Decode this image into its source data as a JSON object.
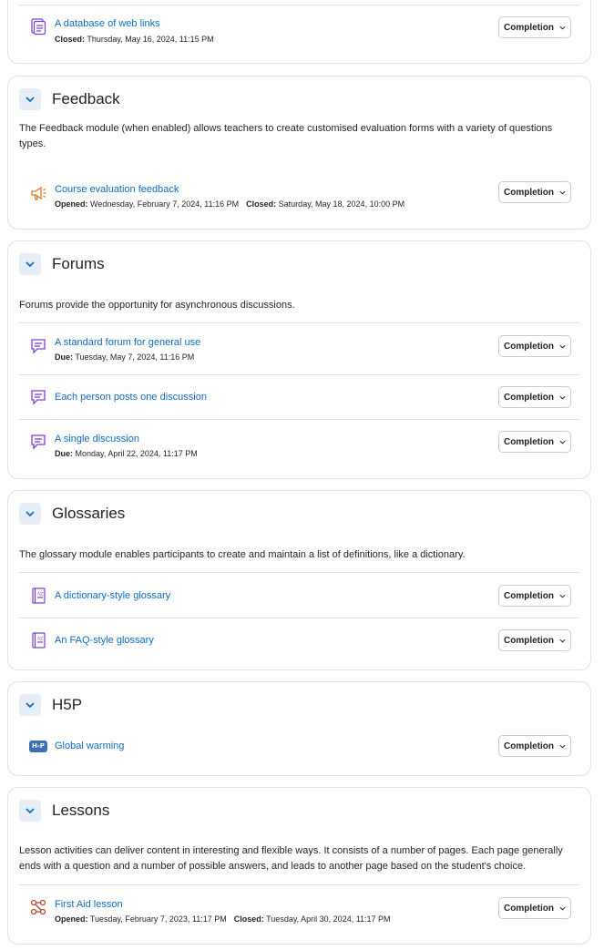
{
  "completion_label": "Completion",
  "sections": {
    "databases": {
      "activities": [
        {
          "name": "A database of web links",
          "date1_label": "Closed:",
          "date1_value": "Thursday, May 16, 2024, 11:15 PM",
          "icon": "database-icon"
        }
      ]
    },
    "feedback": {
      "title": "Feedback",
      "summary": "The Feedback module (when enabled) allows teachers to create customised evaluation forms with a variety of questions types.",
      "activities": [
        {
          "name": "Course evaluation feedback",
          "date1_label": "Opened:",
          "date1_value": "Wednesday, February 7, 2024, 11:16 PM",
          "date2_label": "Closed:",
          "date2_value": "Saturday, May 18, 2024, 10:00 PM",
          "icon": "megaphone-icon"
        }
      ]
    },
    "forums": {
      "title": "Forums",
      "summary": "Forums provide the opportunity for asynchronous discussions.",
      "activities": [
        {
          "name": "A standard forum for general use",
          "date1_label": "Due:",
          "date1_value": "Tuesday, May 7, 2024, 11:16 PM",
          "icon": "forum-icon"
        },
        {
          "name": "Each person posts one discussion",
          "icon": "forum-icon"
        },
        {
          "name": "A single discussion",
          "date1_label": "Due:",
          "date1_value": "Monday, April 22, 2024, 11:17 PM",
          "icon": "forum-icon"
        }
      ]
    },
    "glossaries": {
      "title": "Glossaries",
      "summary": "The glossary module enables participants to create and maintain a list of definitions, like a dictionary.",
      "activities": [
        {
          "name": "A dictionary-style glossary",
          "icon": "glossary-icon"
        },
        {
          "name": "An FAQ-style glossary",
          "icon": "glossary-icon"
        }
      ]
    },
    "h5p": {
      "title": "H5P",
      "activities": [
        {
          "name": "Global warming",
          "icon": "h5p-icon",
          "badge": "H-P"
        }
      ]
    },
    "lessons": {
      "title": "Lessons",
      "summary": "Lesson activities can deliver content in interesting and flexible ways. It consists of a number of pages. Each page generally ends with a question and a number of possible answers, and leads to another page based on the student's choice.",
      "activities": [
        {
          "name": "First Aid lesson",
          "date1_label": "Opened:",
          "date1_value": "Tuesday, February 7, 2023, 11:17 PM",
          "date2_label": "Closed:",
          "date2_value": "Tuesday, April 30, 2024, 11:17 PM",
          "icon": "lesson-icon"
        }
      ]
    }
  },
  "colors": {
    "link": "#0f6cbf",
    "collaboration_purple": "#7d3bd8",
    "communication_orange": "#e0792b",
    "h5p_blue": "#3d6fb5",
    "lesson_red": "#b34a2f"
  }
}
